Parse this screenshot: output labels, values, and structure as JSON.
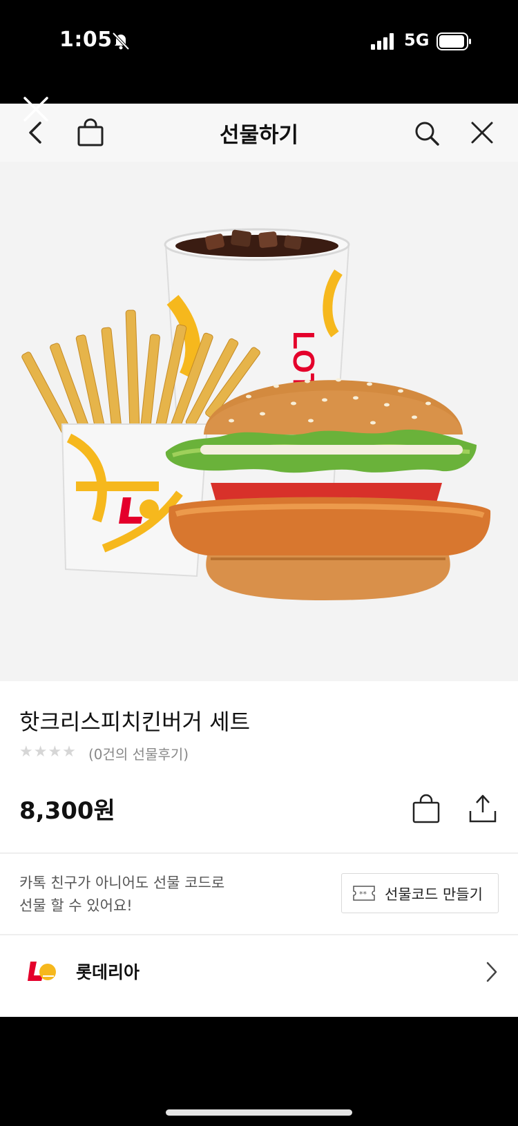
{
  "status_bar": {
    "time": "1:05",
    "network": "5G",
    "icons": [
      "bell-off-icon",
      "signal-icon",
      "battery-icon"
    ]
  },
  "header": {
    "title": "선물하기",
    "icons": [
      "back-icon",
      "shopping-bag-icon",
      "search-icon",
      "close-icon"
    ]
  },
  "product": {
    "name": "핫크리스피치킨버거 세트",
    "rating_stars": "★★★★",
    "review_count": "(0건의 선물후기)",
    "price": "8,300원",
    "image_cup_text": "LOTT"
  },
  "gift_code": {
    "info_line1": "카톡 친구가 아니어도 선물 코드로",
    "info_line2": "선물 할 수 있어요!",
    "button_label": "선물코드 만들기"
  },
  "brand": {
    "name": "롯데리아",
    "logo_text": "L"
  },
  "colors": {
    "brand_red": "#e4002b",
    "brand_yellow": "#f6b81d",
    "header_bg": "#f7f7f7",
    "star_gray": "#d6d6d6"
  }
}
